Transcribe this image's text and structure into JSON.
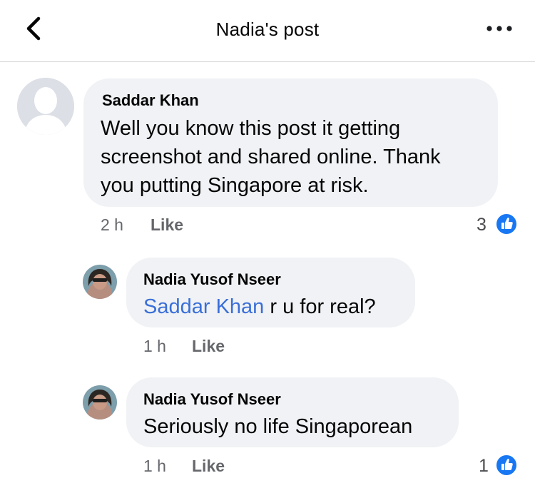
{
  "header": {
    "title": "Nadia's post"
  },
  "comments": [
    {
      "author": "Saddar Khan",
      "lines": [
        "Well you know this post it getting",
        "screenshot and shared online. Thank",
        "you putting Singapore at risk."
      ],
      "time": "2 h",
      "like_label": "Like",
      "reaction_count": "3"
    },
    {
      "author": "Nadia Yusof Nseer",
      "mention": "Saddar Khan",
      "text": " r u for real?",
      "time": "1 h",
      "like_label": "Like"
    },
    {
      "author": "Nadia Yusof Nseer",
      "text": "Seriously no life Singaporean",
      "time": "1 h",
      "like_label": "Like",
      "reaction_count": "1"
    }
  ],
  "colors": {
    "bubble": "#f0f2f5",
    "mention": "#3a6fd8",
    "like_badge": "#1877f2",
    "meta_text": "#65676b"
  },
  "icons": [
    "chevron-left-icon",
    "more-dots-icon",
    "default-avatar-icon",
    "thumbs-up-icon"
  ]
}
